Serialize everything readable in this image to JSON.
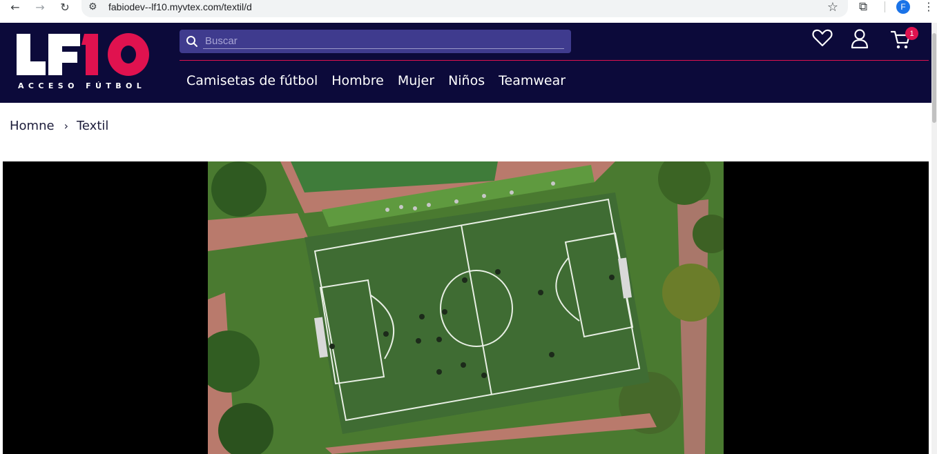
{
  "browser": {
    "url": "fabiodev--lf10.myvtex.com/textil/d",
    "profile_initial": "F"
  },
  "header": {
    "logo_text": "LF10",
    "logo_tagline": "ACCESO FÚTBOL",
    "search_placeholder": "Buscar",
    "cart_count": "1",
    "brand_accent": "#e0124f",
    "background": "#0c0a3a",
    "menu": [
      {
        "label": "Camisetas de fútbol"
      },
      {
        "label": "Hombre"
      },
      {
        "label": "Mujer"
      },
      {
        "label": "Niños"
      },
      {
        "label": "Teamwear"
      }
    ]
  },
  "breadcrumb": {
    "home": "Homne",
    "separator": "›",
    "current": "Textil"
  },
  "icons": {
    "back": "arrow-left-icon",
    "forward": "arrow-right-icon",
    "reload": "reload-icon",
    "site_info": "tune-icon",
    "bookmark": "star-icon",
    "extensions": "puzzle-icon",
    "menu": "more-vert-icon",
    "search": "search-icon",
    "wishlist": "heart-icon",
    "account": "user-icon",
    "cart": "cart-icon"
  }
}
